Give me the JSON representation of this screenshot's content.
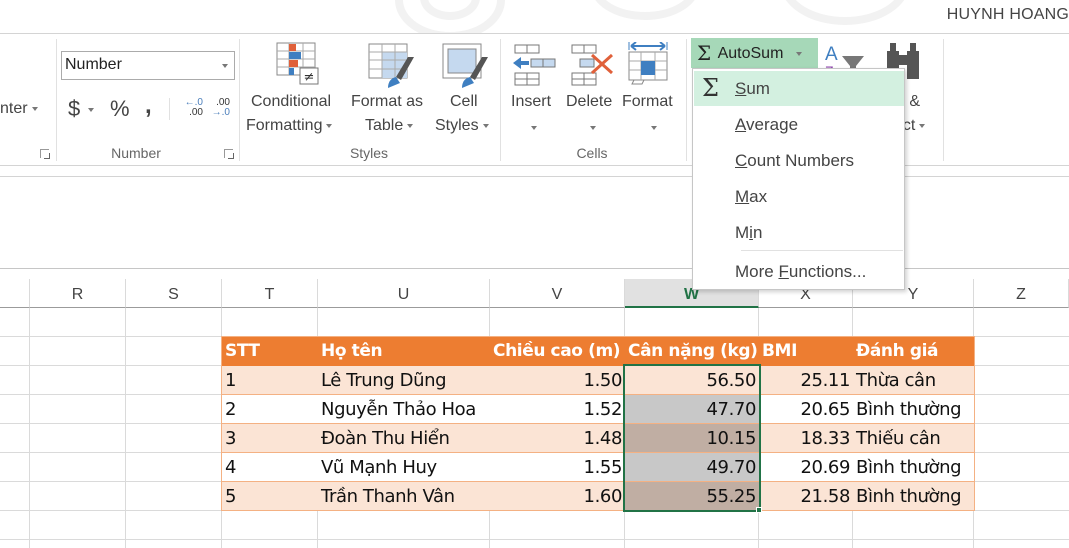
{
  "titlebar": {
    "user": "HUYNH HOANG"
  },
  "ribbon": {
    "alignment_partial_label": "nter",
    "number_group": {
      "format_value": "Number",
      "currency_symbol": "$",
      "percent_symbol": "%",
      "comma_symbol": ",",
      "inc_decimal_top": "←.0",
      "inc_decimal_bottom": ".00",
      "dec_decimal_top": ".00",
      "dec_decimal_bottom": "→.0",
      "label": "Number"
    },
    "styles_group": {
      "conditional_formatting_line1": "Conditional",
      "conditional_formatting_line2": "Formatting",
      "format_as_table_line1": "Format as",
      "format_as_table_line2": "Table",
      "cell_styles_line1": "Cell",
      "cell_styles_line2": "Styles",
      "label": "Styles"
    },
    "cells_group": {
      "insert": "Insert",
      "delete": "Delete",
      "format": "Format",
      "label": "Cells"
    },
    "editing_group": {
      "autosum": "AutoSum",
      "find_select_line1": "d &",
      "find_select_line2": "ect"
    }
  },
  "autosum_menu": {
    "items": [
      {
        "label": "Sum",
        "accel": "S",
        "rest": "um",
        "pre": ""
      },
      {
        "label": "Average",
        "accel": "A",
        "rest": "verage",
        "pre": ""
      },
      {
        "label": "Count Numbers",
        "accel": "C",
        "rest": "ount Numbers",
        "pre": ""
      },
      {
        "label": "Max",
        "accel": "M",
        "rest": "ax",
        "pre": ""
      },
      {
        "label": "Min",
        "accel": "i",
        "rest": "n",
        "pre": "M"
      },
      {
        "label": "More Functions...",
        "accel": "F",
        "rest": "unctions...",
        "pre": "More "
      }
    ]
  },
  "sheet": {
    "columns": [
      "R",
      "S",
      "T",
      "U",
      "V",
      "W",
      "X",
      "Y",
      "Z"
    ],
    "selected_column": "W",
    "table": {
      "headers": [
        "STT",
        "Họ tên",
        "Chiều cao (m)",
        "Cân nặng (kg)",
        "BMI",
        "Đánh giá"
      ],
      "rows": [
        [
          "1",
          "Lê Trung Dũng",
          "1.50",
          "56.50",
          "25.11",
          "Thừa cân"
        ],
        [
          "2",
          "Nguyễn Thảo Hoa",
          "1.52",
          "47.70",
          "20.65",
          "Bình thường"
        ],
        [
          "3",
          "Đoàn Thu Hiển",
          "1.48",
          "10.15",
          "18.33",
          "Thiếu cân"
        ],
        [
          "4",
          "Vũ Mạnh Huy",
          "1.55",
          "49.70",
          "20.69",
          "Bình thường"
        ],
        [
          "5",
          "Trần Thanh Vân",
          "1.60",
          "55.25",
          "21.58",
          "Bình thường"
        ]
      ]
    },
    "colors": {
      "header_bg": "#ed7d31",
      "band_bg": "#fbe4d5",
      "selection": "#217346"
    }
  }
}
